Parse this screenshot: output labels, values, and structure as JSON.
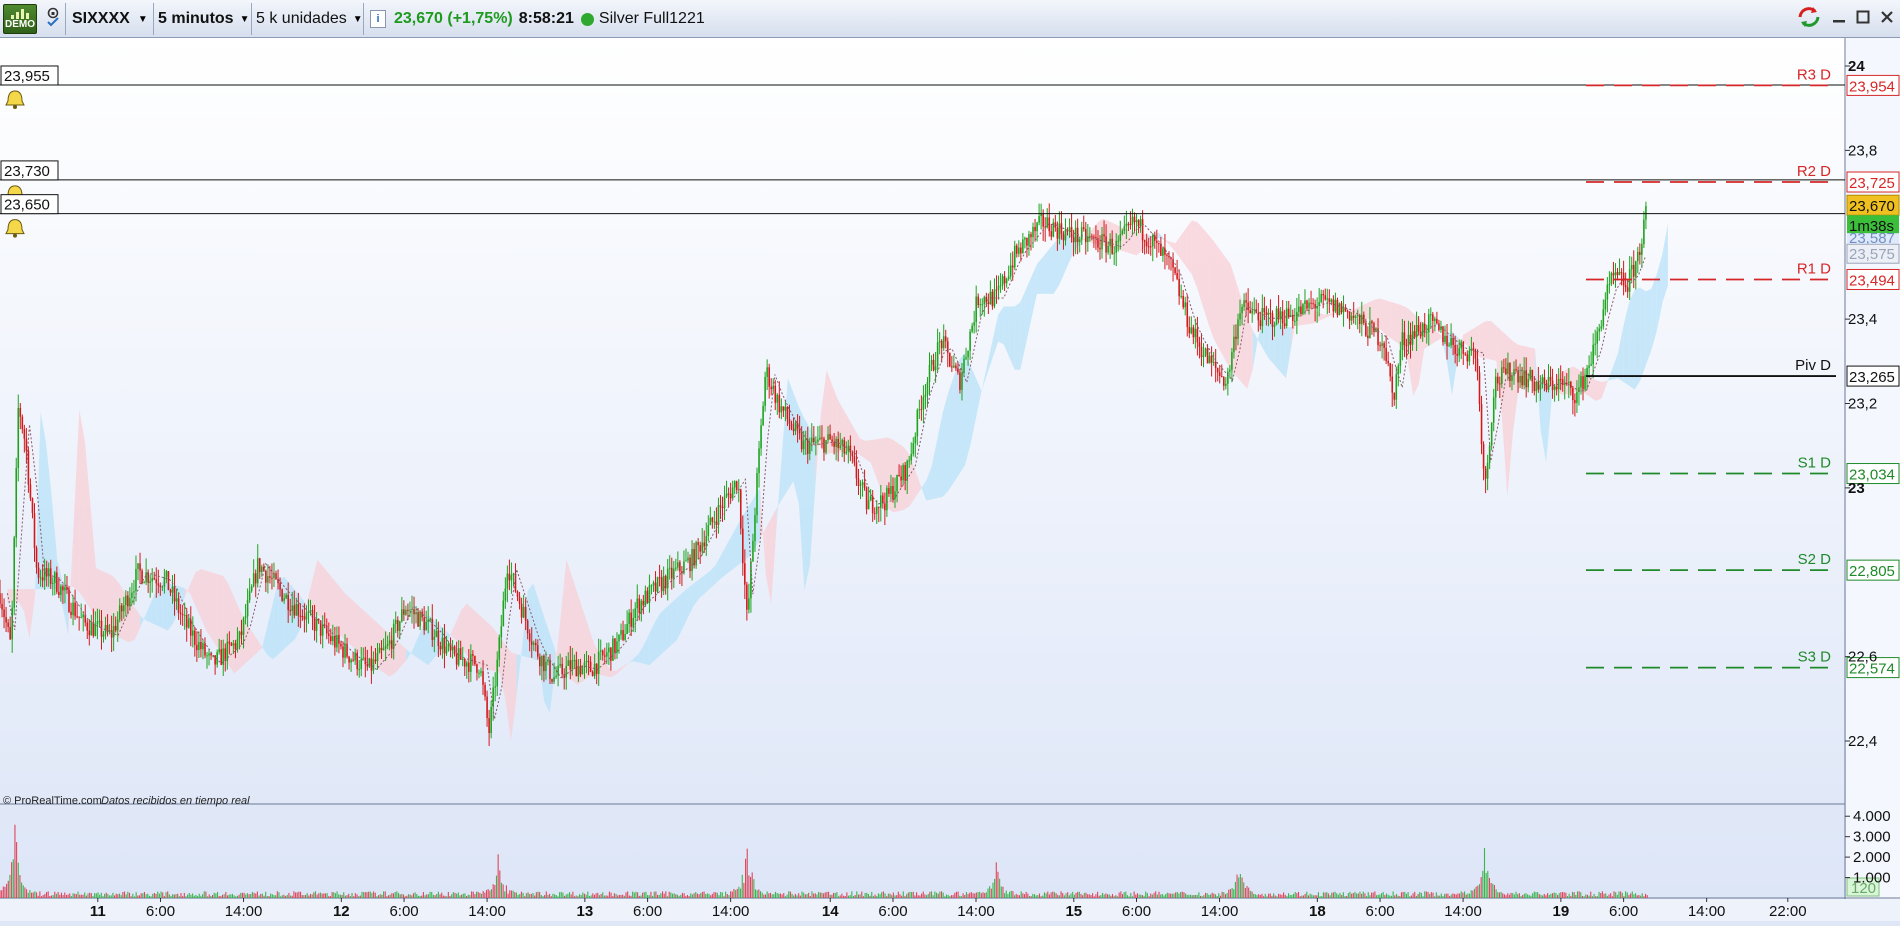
{
  "toolbar": {
    "demo_label": "DEMO",
    "instrument": "SIXXXX",
    "timeframe": "5 minutos",
    "units": "5 k unidades",
    "info_icon": "i",
    "last_price": "23,670 (+1,75%)",
    "time": "8:58:21",
    "status_dot_color": "#2ea82e",
    "account": "Silver Full1221"
  },
  "alerts": [
    {
      "label": "23,955",
      "price": 23.955
    },
    {
      "label": "23,730",
      "price": 23.73
    },
    {
      "label": "23,650",
      "price": 23.65
    }
  ],
  "pivots": [
    {
      "name": "R3 D",
      "value_label": "23,954",
      "price": 23.954,
      "color": "#d62728",
      "kind": "resistance"
    },
    {
      "name": "R2 D",
      "value_label": "23,725",
      "price": 23.725,
      "color": "#d62728",
      "kind": "resistance"
    },
    {
      "name": "R1 D",
      "value_label": "23,494",
      "price": 23.494,
      "color": "#d62728",
      "kind": "resistance"
    },
    {
      "name": "Piv D",
      "value_label": "23,265",
      "price": 23.265,
      "color": "#111111",
      "kind": "pivot"
    },
    {
      "name": "S1 D",
      "value_label": "23,034",
      "price": 23.034,
      "color": "#1f8a2a",
      "kind": "support"
    },
    {
      "name": "S2 D",
      "value_label": "22,805",
      "price": 22.805,
      "color": "#1f8a2a",
      "kind": "support"
    },
    {
      "name": "S3 D",
      "value_label": "22,574",
      "price": 22.574,
      "color": "#1f8a2a",
      "kind": "support"
    }
  ],
  "price_tags": {
    "current": "23,670",
    "countdown": "1m38s",
    "cloud_a": "23,587",
    "cloud_b": "23,575"
  },
  "copyright": "© ProRealTime.com",
  "realtime_note": "Datos recibidos en tiempo real",
  "volume_tag": "120",
  "chart_data": {
    "type": "candlestick",
    "instrument": "SIXXXX",
    "interval": "5 minutos",
    "ylim": [
      22.3,
      24.05
    ],
    "y_ticks": [
      {
        "label": "24",
        "v": 24.0,
        "bold": true
      },
      {
        "label": "23,8",
        "v": 23.8,
        "bold": false
      },
      {
        "label": "23,4",
        "v": 23.4,
        "bold": false
      },
      {
        "label": "23,2",
        "v": 23.2,
        "bold": false
      },
      {
        "label": "23",
        "v": 23.0,
        "bold": true
      },
      {
        "label": "22,6",
        "v": 22.6,
        "bold": false
      },
      {
        "label": "22,4",
        "v": 22.4,
        "bold": false
      }
    ],
    "x_ticks": [
      {
        "label": "11",
        "t": 0.053,
        "bold": true
      },
      {
        "label": "6:00",
        "t": 0.087,
        "bold": false
      },
      {
        "label": "14:00",
        "t": 0.132,
        "bold": false
      },
      {
        "label": "12",
        "t": 0.185,
        "bold": true
      },
      {
        "label": "6:00",
        "t": 0.219,
        "bold": false
      },
      {
        "label": "14:00",
        "t": 0.264,
        "bold": false
      },
      {
        "label": "13",
        "t": 0.317,
        "bold": true
      },
      {
        "label": "6:00",
        "t": 0.351,
        "bold": false
      },
      {
        "label": "14:00",
        "t": 0.396,
        "bold": false
      },
      {
        "label": "14",
        "t": 0.45,
        "bold": true
      },
      {
        "label": "6:00",
        "t": 0.484,
        "bold": false
      },
      {
        "label": "14:00",
        "t": 0.529,
        "bold": false
      },
      {
        "label": "15",
        "t": 0.582,
        "bold": true
      },
      {
        "label": "6:00",
        "t": 0.616,
        "bold": false
      },
      {
        "label": "14:00",
        "t": 0.661,
        "bold": false
      },
      {
        "label": "18",
        "t": 0.714,
        "bold": true
      },
      {
        "label": "6:00",
        "t": 0.748,
        "bold": false
      },
      {
        "label": "14:00",
        "t": 0.793,
        "bold": false
      },
      {
        "label": "19",
        "t": 0.846,
        "bold": true
      },
      {
        "label": "6:00",
        "t": 0.88,
        "bold": false
      },
      {
        "label": "14:00",
        "t": 0.925,
        "bold": false
      },
      {
        "label": "22:00",
        "t": 0.969,
        "bold": false
      }
    ],
    "price_path": [
      [
        0.0,
        22.75
      ],
      [
        0.006,
        22.62
      ],
      [
        0.01,
        23.2
      ],
      [
        0.014,
        23.1
      ],
      [
        0.02,
        22.8
      ],
      [
        0.03,
        22.78
      ],
      [
        0.045,
        22.68
      ],
      [
        0.06,
        22.65
      ],
      [
        0.075,
        22.8
      ],
      [
        0.09,
        22.78
      ],
      [
        0.1,
        22.68
      ],
      [
        0.115,
        22.58
      ],
      [
        0.13,
        22.64
      ],
      [
        0.14,
        22.82
      ],
      [
        0.155,
        22.74
      ],
      [
        0.17,
        22.68
      ],
      [
        0.19,
        22.6
      ],
      [
        0.2,
        22.57
      ],
      [
        0.21,
        22.62
      ],
      [
        0.22,
        22.72
      ],
      [
        0.235,
        22.66
      ],
      [
        0.245,
        22.6
      ],
      [
        0.26,
        22.58
      ],
      [
        0.265,
        22.42
      ],
      [
        0.27,
        22.6
      ],
      [
        0.275,
        22.82
      ],
      [
        0.29,
        22.62
      ],
      [
        0.3,
        22.55
      ],
      [
        0.31,
        22.58
      ],
      [
        0.32,
        22.57
      ],
      [
        0.335,
        22.63
      ],
      [
        0.345,
        22.72
      ],
      [
        0.36,
        22.78
      ],
      [
        0.375,
        22.83
      ],
      [
        0.39,
        22.95
      ],
      [
        0.4,
        23.02
      ],
      [
        0.405,
        22.68
      ],
      [
        0.41,
        23.0
      ],
      [
        0.415,
        23.28
      ],
      [
        0.422,
        23.2
      ],
      [
        0.435,
        23.1
      ],
      [
        0.45,
        23.11
      ],
      [
        0.46,
        23.08
      ],
      [
        0.47,
        22.96
      ],
      [
        0.48,
        22.97
      ],
      [
        0.492,
        23.05
      ],
      [
        0.5,
        23.22
      ],
      [
        0.51,
        23.35
      ],
      [
        0.52,
        23.25
      ],
      [
        0.53,
        23.45
      ],
      [
        0.54,
        23.45
      ],
      [
        0.55,
        23.55
      ],
      [
        0.565,
        23.63
      ],
      [
        0.58,
        23.6
      ],
      [
        0.59,
        23.59
      ],
      [
        0.605,
        23.57
      ],
      [
        0.615,
        23.63
      ],
      [
        0.625,
        23.58
      ],
      [
        0.635,
        23.52
      ],
      [
        0.645,
        23.38
      ],
      [
        0.655,
        23.3
      ],
      [
        0.665,
        23.25
      ],
      [
        0.672,
        23.43
      ],
      [
        0.685,
        23.4
      ],
      [
        0.7,
        23.41
      ],
      [
        0.715,
        23.44
      ],
      [
        0.73,
        23.42
      ],
      [
        0.74,
        23.38
      ],
      [
        0.75,
        23.35
      ],
      [
        0.755,
        23.21
      ],
      [
        0.76,
        23.35
      ],
      [
        0.775,
        23.39
      ],
      [
        0.79,
        23.33
      ],
      [
        0.8,
        23.32
      ],
      [
        0.805,
        23.0
      ],
      [
        0.81,
        23.25
      ],
      [
        0.82,
        23.28
      ],
      [
        0.835,
        23.24
      ],
      [
        0.845,
        23.25
      ],
      [
        0.855,
        23.22
      ],
      [
        0.865,
        23.34
      ],
      [
        0.87,
        23.45
      ],
      [
        0.875,
        23.5
      ],
      [
        0.882,
        23.48
      ],
      [
        0.888,
        23.55
      ],
      [
        0.893,
        23.67
      ]
    ],
    "volume_ylim": [
      0,
      4500
    ],
    "volume_ticks": [
      {
        "label": "4.000",
        "v": 4000
      },
      {
        "label": "3.000",
        "v": 3000
      },
      {
        "label": "2.000",
        "v": 2000
      },
      {
        "label": "1.000",
        "v": 1000
      }
    ],
    "volume_spikes": [
      {
        "t": 0.008,
        "v": 4200
      },
      {
        "t": 0.27,
        "v": 2200
      },
      {
        "t": 0.405,
        "v": 2800
      },
      {
        "t": 0.54,
        "v": 1700
      },
      {
        "t": 0.672,
        "v": 2100
      },
      {
        "t": 0.805,
        "v": 2900
      }
    ]
  }
}
